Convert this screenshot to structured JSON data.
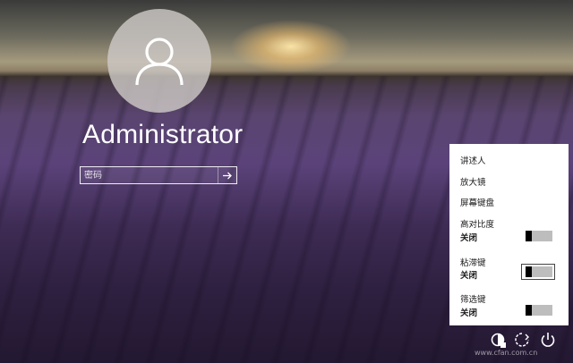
{
  "user": {
    "name": "Administrator"
  },
  "password": {
    "placeholder": "密码"
  },
  "ease_of_access": {
    "narrator": "讲述人",
    "magnifier": "放大镜",
    "onscreen_keyboard": "屏幕键盘",
    "high_contrast": {
      "label": "高对比度",
      "state": "关闭"
    },
    "sticky_keys": {
      "label": "粘滞键",
      "state": "关闭"
    },
    "filter_keys": {
      "label": "筛选键",
      "state": "关闭"
    }
  },
  "watermark": "www.cfan.com.cn",
  "icons": [
    "user-icon",
    "arrow-right-icon",
    "ease-of-access-icon",
    "network-icon",
    "power-icon"
  ]
}
